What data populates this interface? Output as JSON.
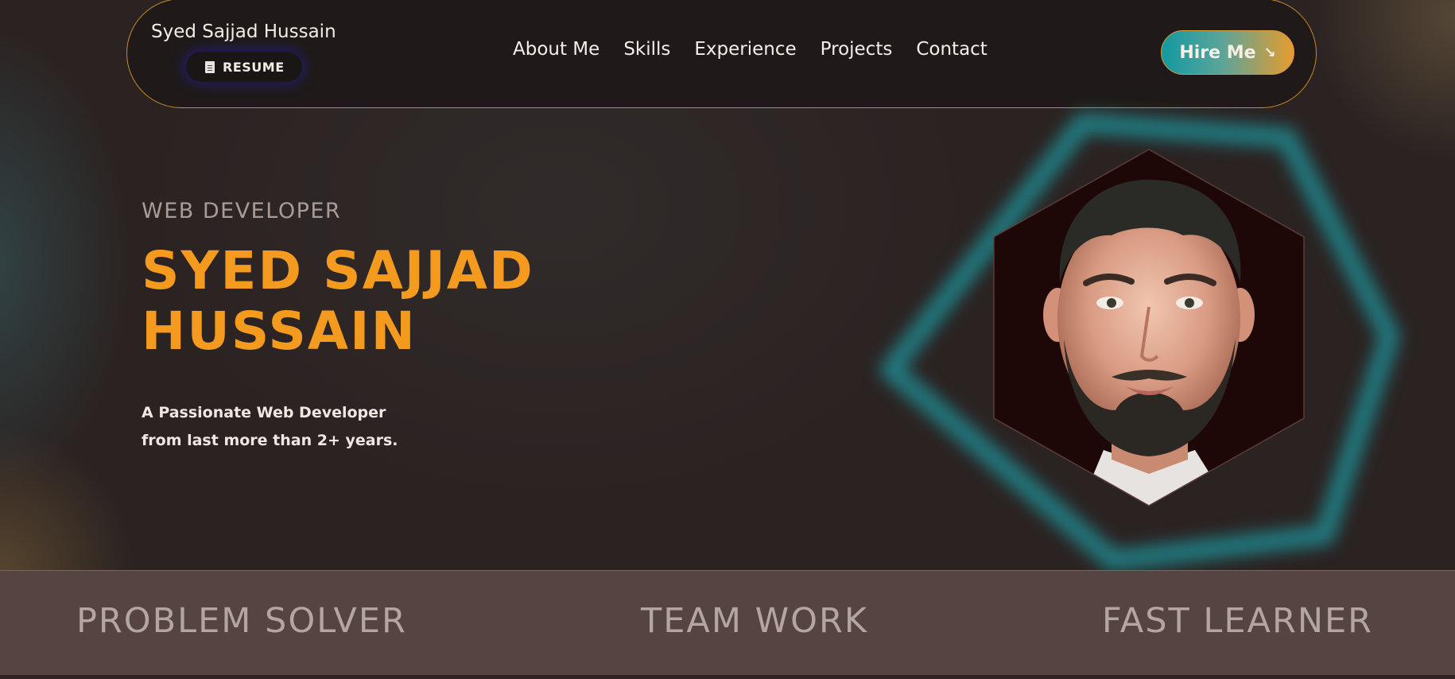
{
  "header": {
    "brand": "Syed Sajjad Hussain",
    "resume_label": "RESUME",
    "nav": [
      {
        "label": "About Me"
      },
      {
        "label": "Skills"
      },
      {
        "label": "Experience"
      },
      {
        "label": "Projects"
      },
      {
        "label": "Contact"
      }
    ],
    "hire_label": "Hire Me",
    "hire_icon": "↘"
  },
  "hero": {
    "role": "WEB DEVELOPER",
    "name_line1": "SYED SAJJAD",
    "name_line2": "HUSSAIN",
    "tagline_line1": "A Passionate Web Developer",
    "tagline_line2": "from last more than 2+ years."
  },
  "strip": {
    "items": [
      {
        "label": "PROBLEM SOLVER"
      },
      {
        "label": "TEAM WORK"
      },
      {
        "label": "FAST LEARNER"
      }
    ]
  },
  "colors": {
    "accent": "#f39a1f",
    "teal": "#129aa1",
    "background": "#2b2322",
    "strip": "#554442"
  },
  "icons": {
    "resume": "document-icon",
    "hire": "arrow-down-right-icon"
  }
}
